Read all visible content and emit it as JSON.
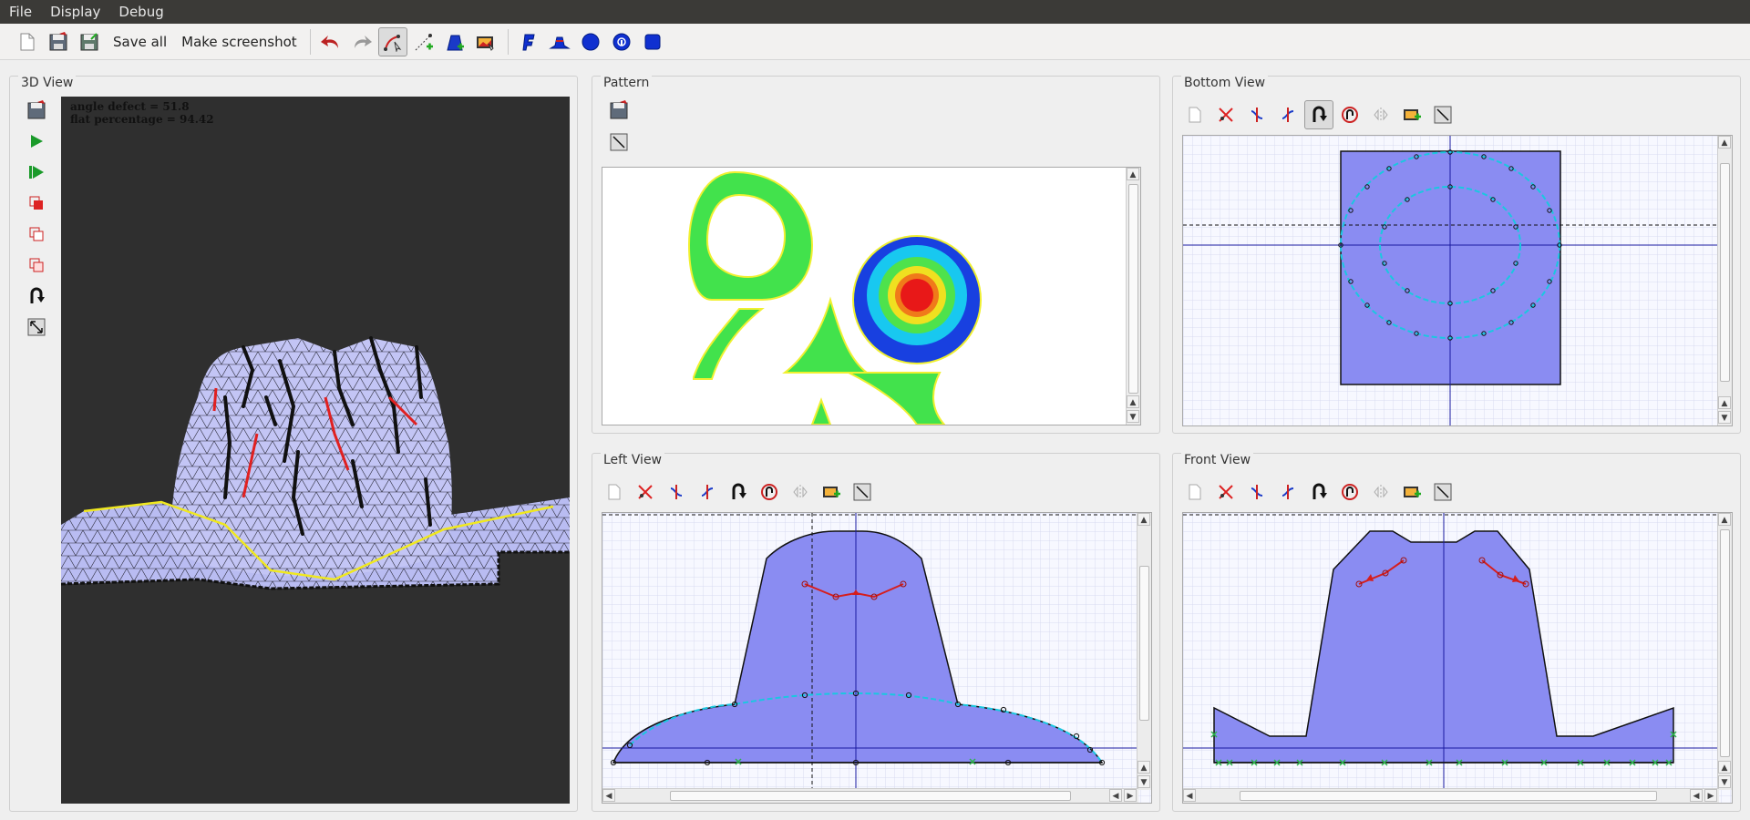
{
  "menu": [
    "File",
    "Display",
    "Debug"
  ],
  "toolbar": {
    "save_all": "Save all",
    "make_screenshot": "Make screenshot",
    "icons": [
      "new-file-icon",
      "save-icon",
      "save-as-icon",
      "undo-icon",
      "redo-icon",
      "select-curve-icon",
      "add-point-icon",
      "add-shape-icon",
      "screenshot-icon",
      "flag-icon",
      "hat-icon",
      "circle-icon",
      "circle-lock-icon",
      "square-icon"
    ]
  },
  "panels": {
    "view3d": {
      "title": "3D View",
      "overlay": {
        "angle_defect": "angle defect = 51.8",
        "flat_percentage": "flat percentage = 94.42"
      }
    },
    "pattern": {
      "title": "Pattern"
    },
    "bottom": {
      "title": "Bottom View"
    },
    "left": {
      "title": "Left View"
    },
    "front": {
      "title": "Front View"
    }
  },
  "colors": {
    "menubar": "#3b3a37",
    "shape_fill": "#8a8cf2",
    "curve_cyan": "#19c8e0",
    "seam_red": "#d51e1e",
    "mesh_gray": "#b9bcf2",
    "pattern_green": "#3be24a"
  }
}
